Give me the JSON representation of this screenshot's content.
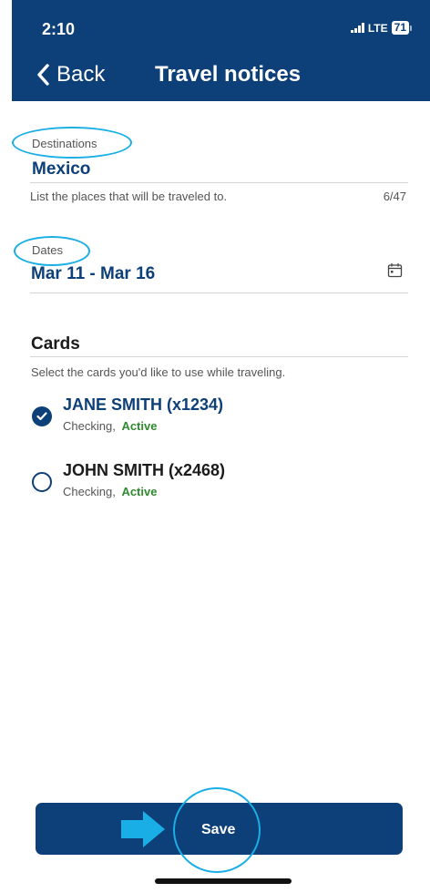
{
  "status_bar": {
    "time": "2:10",
    "network": "LTE",
    "battery": "71"
  },
  "nav": {
    "back_label": "Back",
    "title": "Travel notices"
  },
  "destinations": {
    "label": "Destinations",
    "value": "Mexico",
    "helper": "List the places that will be traveled to.",
    "counter": "6/47"
  },
  "dates": {
    "label": "Dates",
    "value": "Mar 11 - Mar 16",
    "icon": "calendar-icon"
  },
  "cards": {
    "title": "Cards",
    "helper": "Select the cards you'd like to use while traveling.",
    "items": [
      {
        "name": "JANE SMITH (x1234)",
        "type": "Checking,",
        "status": "Active",
        "selected": true
      },
      {
        "name": "JOHN SMITH (x2468)",
        "type": "Checking,",
        "status": "Active",
        "selected": false
      }
    ]
  },
  "save_label": "Save",
  "colors": {
    "brand": "#0d3f78",
    "annotation": "#19aee6",
    "active": "#2f8a2f"
  }
}
